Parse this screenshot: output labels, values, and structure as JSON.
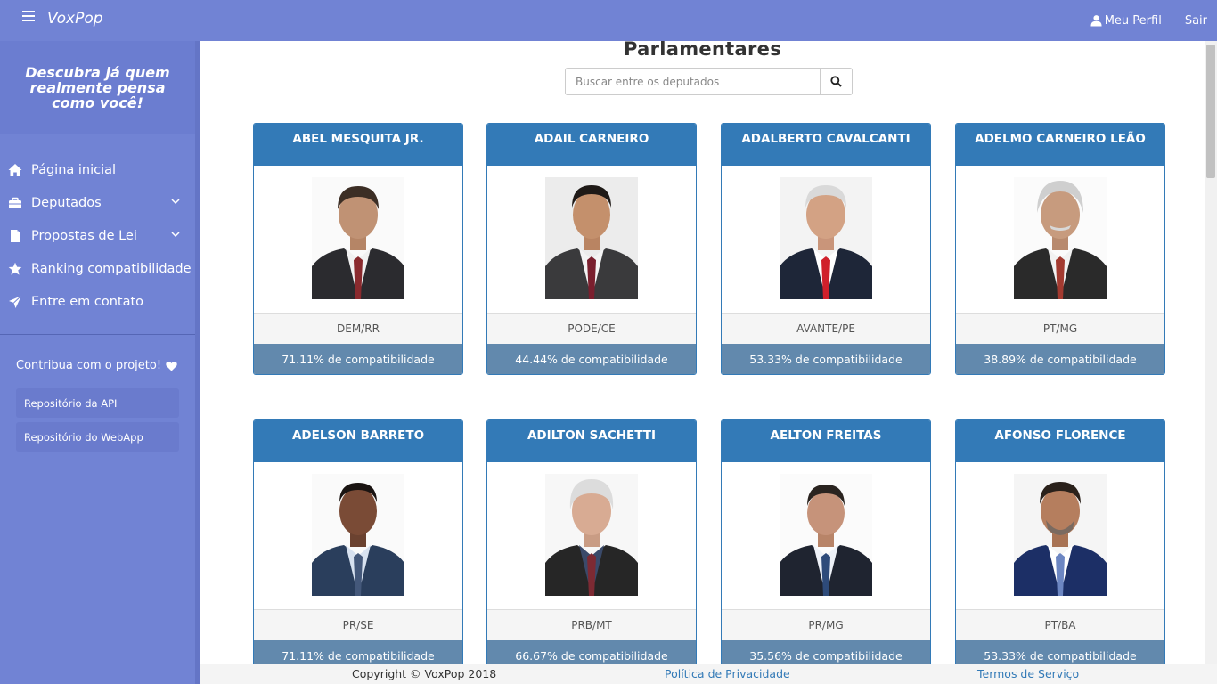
{
  "brand": "VoxPop",
  "topbar": {
    "profile_label": "Meu Perfil",
    "logout_label": "Sair"
  },
  "sidebar": {
    "tagline": "Descubra já quem realmente pensa como você!",
    "items": [
      {
        "label": "Página inicial",
        "icon": "home-icon"
      },
      {
        "label": "Deputados",
        "icon": "briefcase-icon"
      },
      {
        "label": "Propostas de Lei",
        "icon": "file-icon"
      },
      {
        "label": "Ranking compatibilidade",
        "icon": "star-icon"
      },
      {
        "label": "Entre em contato",
        "icon": "send-icon"
      }
    ],
    "contribute": "Contribua com o projeto!",
    "repos": [
      "Repositório da API",
      "Repositório do WebApp"
    ]
  },
  "main": {
    "title": "Parlamentares",
    "search_placeholder": "Buscar entre os deputados"
  },
  "cards": [
    {
      "name": "ABEL MESQUITA JR.",
      "party": "DEM/RR",
      "compat": "71.11% de compatibilidade"
    },
    {
      "name": "ADAIL CARNEIRO",
      "party": "PODE/CE",
      "compat": "44.44% de compatibilidade"
    },
    {
      "name": "ADALBERTO CAVALCANTI",
      "party": "AVANTE/PE",
      "compat": "53.33% de compatibilidade"
    },
    {
      "name": "ADELMO CARNEIRO LEÃO",
      "party": "PT/MG",
      "compat": "38.89% de compatibilidade"
    },
    {
      "name": "ADELSON BARRETO",
      "party": "PR/SE",
      "compat": "71.11% de compatibilidade"
    },
    {
      "name": "ADILTON SACHETTI",
      "party": "PRB/MT",
      "compat": "66.67% de compatibilidade"
    },
    {
      "name": "AELTON FREITAS",
      "party": "PR/MG",
      "compat": "35.56% de compatibilidade"
    },
    {
      "name": "AFONSO FLORENCE",
      "party": "PT/BA",
      "compat": "53.33% de compatibilidade"
    }
  ],
  "footer": {
    "copyright": "Copyright © VoxPop 2018",
    "privacy": "Política de Privacidade",
    "terms": "Termos de Serviço"
  },
  "colors": {
    "nav": "#7183d4",
    "card_header": "#337ab7",
    "compat_bar": "#6289ad"
  }
}
